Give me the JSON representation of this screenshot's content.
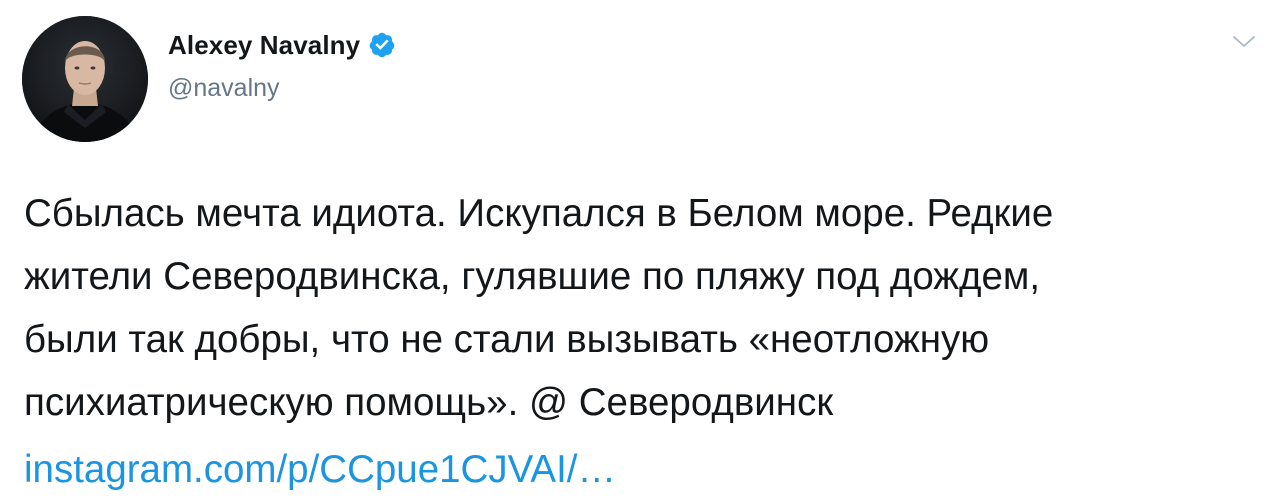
{
  "author": {
    "display_name": "Alexey Navalny",
    "handle": "@navalny",
    "verified": true,
    "avatar_icon": "profile-photo"
  },
  "menu": {
    "icon": "chevron-down-icon"
  },
  "tweet": {
    "lines": [
      "Сбылась мечта идиота. Искупался в Белом море. Редкие",
      "жители Северодвинска, гулявшие по пляжу под дождем,",
      "были так добры, что не стали вызывать «неотложную",
      "психиатрическую помощь». @ Северодвинск"
    ],
    "link_text": "instagram.com/p/CCpue1CJVAI/…"
  },
  "colors": {
    "text": "#14171a",
    "secondary": "#657786",
    "link": "#1b95e0",
    "verified_badge": "#1da1f2",
    "background": "#ffffff"
  }
}
